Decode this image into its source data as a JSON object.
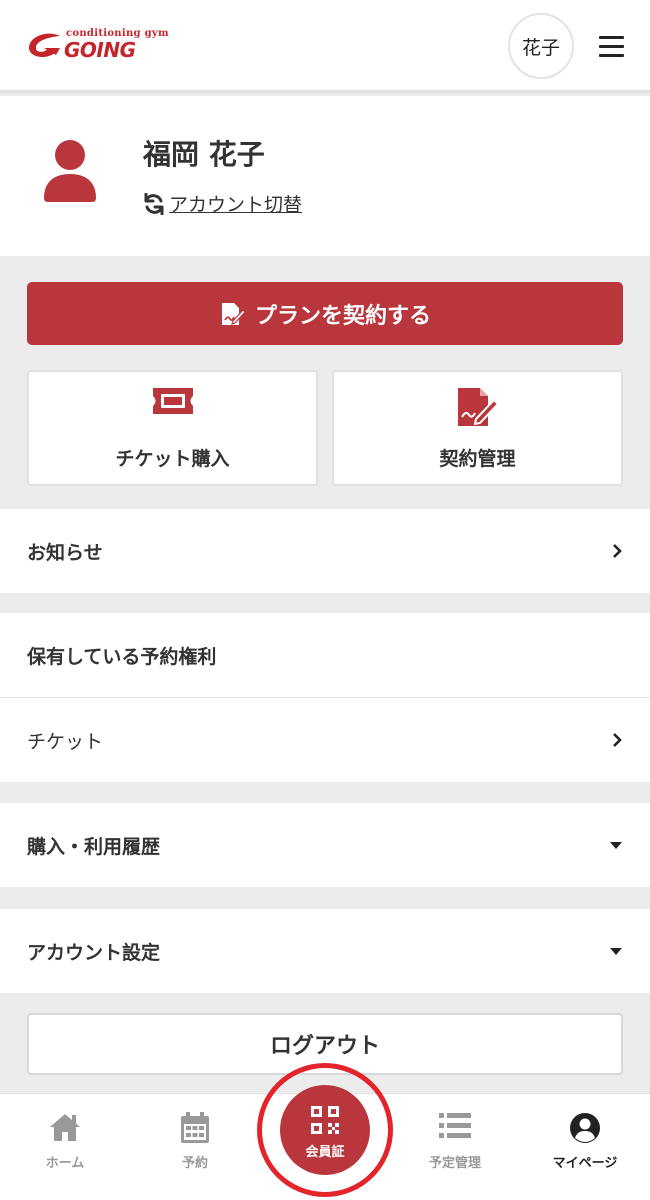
{
  "header": {
    "logo_small": "conditioning gym",
    "logo_main": "GOING",
    "user_short_name": "花子"
  },
  "profile": {
    "name": "福岡 花子",
    "switch_account": "アカウント切替"
  },
  "actions": {
    "plan_label": "プランを契約する",
    "ticket_purchase": "チケット購入",
    "contract_management": "契約管理"
  },
  "sections": {
    "news": "お知らせ",
    "reservation_rights_title": "保有している予約権利",
    "tickets": "チケット",
    "history": "購入・利用履歴",
    "account_settings": "アカウント設定"
  },
  "logout": "ログアウト",
  "bottom_nav": {
    "home": "ホーム",
    "reserve": "予約",
    "member_card": "会員証",
    "schedule": "予定管理",
    "mypage": "マイページ"
  },
  "colors": {
    "brand_red": "#b9373c",
    "logo_red": "#c4252d",
    "highlight_ring": "#e3242b"
  }
}
